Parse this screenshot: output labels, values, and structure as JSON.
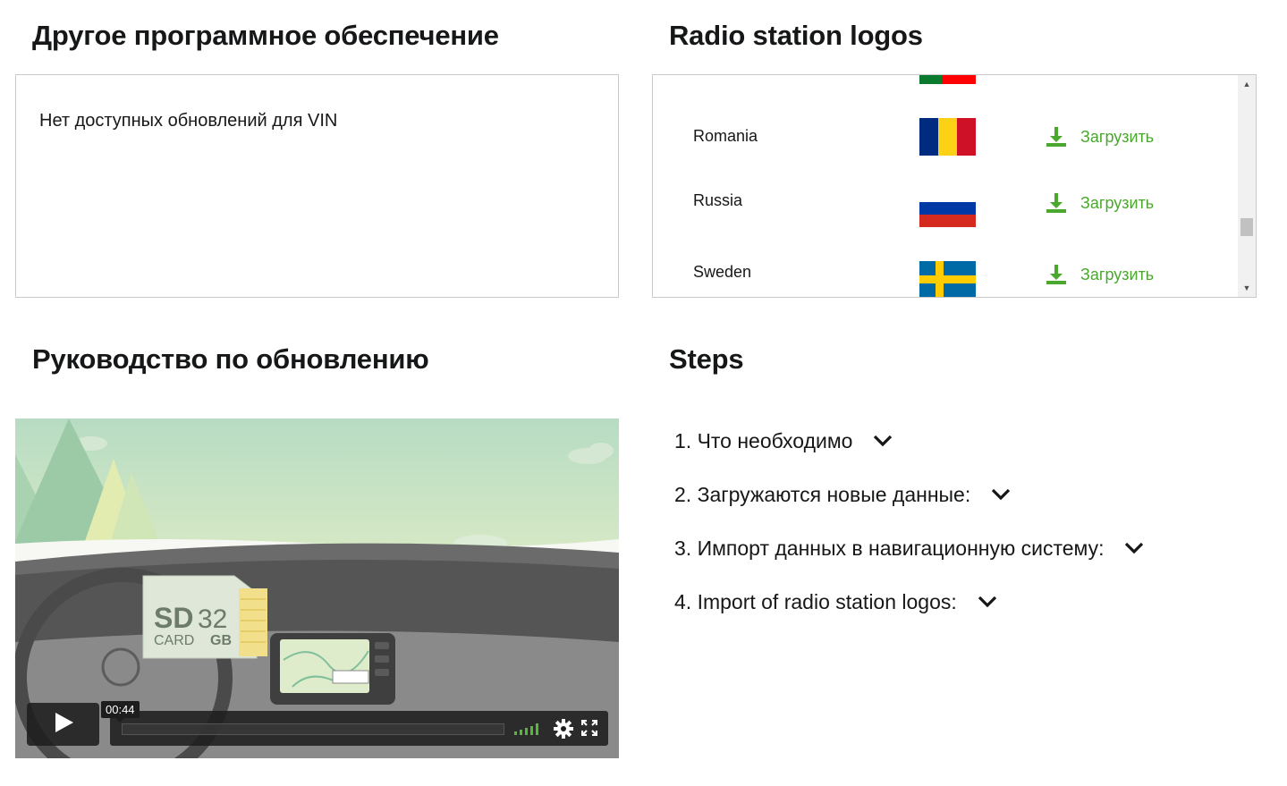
{
  "other_software": {
    "title": "Другое программное обеспечение",
    "message": "Нет доступных обновлений для VIN"
  },
  "radio_logos": {
    "title": "Radio station logos",
    "rows": [
      {
        "country": "",
        "flag": "portugal-flag",
        "download_label": ""
      },
      {
        "country": "Romania",
        "flag": "romania-flag",
        "download_label": "Загрузить"
      },
      {
        "country": "Russia",
        "flag": "russia-flag",
        "download_label": "Загрузить"
      },
      {
        "country": "Sweden",
        "flag": "sweden-flag",
        "download_label": "Загрузить"
      }
    ],
    "accent_color": "#4ba82e"
  },
  "guide": {
    "title": "Руководство по обновлению",
    "video": {
      "time_tooltip": "00:44",
      "sd_card": {
        "line1": "SD",
        "capacity": "32",
        "line2": "CARD",
        "unit": "GB"
      }
    }
  },
  "steps": {
    "title": "Steps",
    "items": [
      {
        "label": "1. Что необходимо"
      },
      {
        "label": "2. Загружаются новые данные:"
      },
      {
        "label": "3. Импорт данных в навигационную систему:"
      },
      {
        "label": "4. Import of radio station logos:"
      }
    ]
  }
}
